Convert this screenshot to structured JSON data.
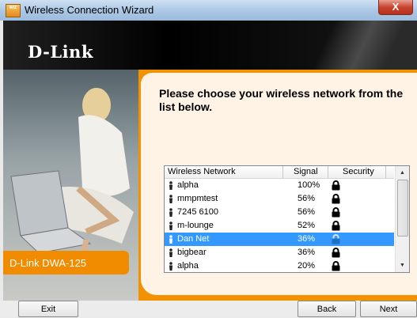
{
  "window": {
    "title": "Wireless Connection Wizard",
    "close_label": "X",
    "app_icon_text": "WIZ"
  },
  "brand": {
    "logo": "D-Link",
    "product": "D-Link DWA-125"
  },
  "main": {
    "heading": "Please choose your wireless network from the list below."
  },
  "network_list": {
    "columns": [
      "Wireless Network",
      "Signal",
      "Security"
    ],
    "rows": [
      {
        "name": "alpha",
        "signal": "100%",
        "secured": true,
        "selected": false
      },
      {
        "name": "mmpmtest",
        "signal": "56%",
        "secured": true,
        "selected": false
      },
      {
        "name": "7245 6100",
        "signal": "56%",
        "secured": true,
        "selected": false
      },
      {
        "name": "m-lounge",
        "signal": "52%",
        "secured": true,
        "selected": false
      },
      {
        "name": "Dan Net",
        "signal": "36%",
        "secured": true,
        "selected": true
      },
      {
        "name": "bigbear",
        "signal": "36%",
        "secured": true,
        "selected": false
      },
      {
        "name": "alpha",
        "signal": "20%",
        "secured": true,
        "selected": false
      }
    ]
  },
  "buttons": {
    "exit": "Exit",
    "back": "Back",
    "next": "Next"
  },
  "icons": {
    "person": "person-icon",
    "lock": "lock-icon",
    "close": "close-icon"
  },
  "colors": {
    "accent_orange": "#f39200",
    "selection_blue": "#3399ff",
    "header_black": "#000000"
  }
}
